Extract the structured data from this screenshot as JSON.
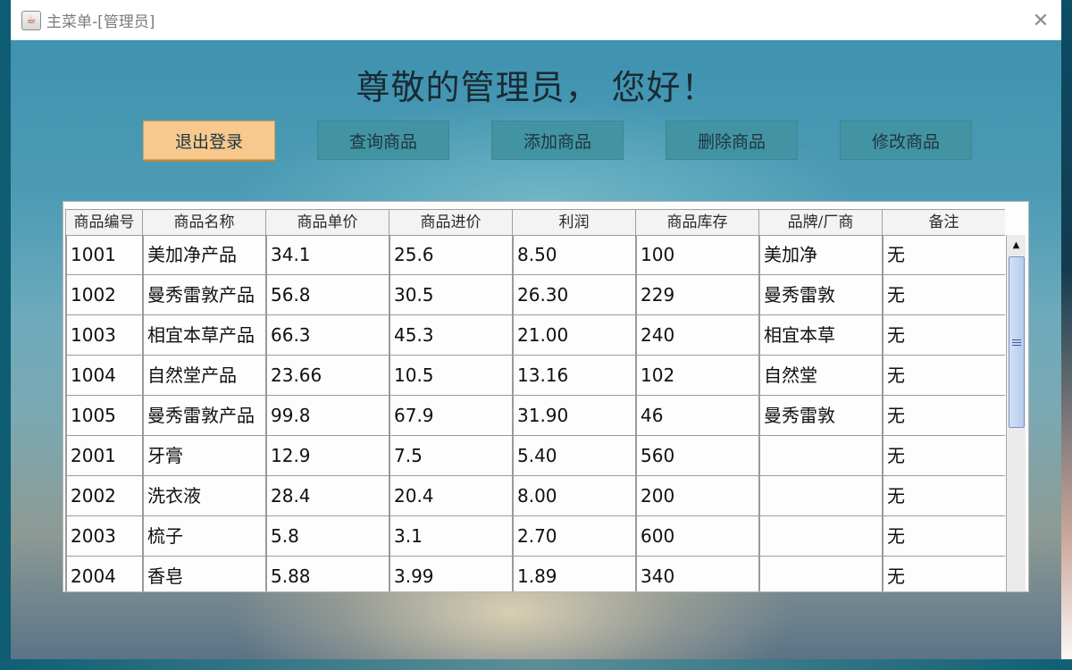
{
  "window": {
    "title": "主菜单-[管理员]",
    "app_icon_glyph": "☕",
    "close_glyph": "✕"
  },
  "greeting": "尊敬的管理员， 您好！",
  "buttons": {
    "logout": "退出登录",
    "query": "查询商品",
    "add": "添加商品",
    "delete": "删除商品",
    "modify": "修改商品"
  },
  "colors": {
    "accent_button": "#f8c98d",
    "normal_button": "#4394a3"
  },
  "table": {
    "headers": [
      "商品编号",
      "商品名称",
      "商品单价",
      "商品进价",
      "利润",
      "商品库存",
      "品牌/厂商",
      "备注"
    ],
    "rows": [
      [
        "1001",
        "美加净产品",
        "34.1",
        "25.6",
        "8.50",
        "100",
        "美加净",
        "无"
      ],
      [
        "1002",
        "曼秀雷敦产品",
        "56.8",
        "30.5",
        "26.30",
        "229",
        "曼秀雷敦",
        "无"
      ],
      [
        "1003",
        "相宜本草产品",
        "66.3",
        "45.3",
        "21.00",
        "240",
        "相宜本草",
        "无"
      ],
      [
        "1004",
        "自然堂产品",
        "23.66",
        "10.5",
        "13.16",
        "102",
        "自然堂",
        "无"
      ],
      [
        "1005",
        "曼秀雷敦产品",
        "99.8",
        "67.9",
        "31.90",
        "46",
        "曼秀雷敦",
        "无"
      ],
      [
        "2001",
        "牙膏",
        "12.9",
        "7.5",
        "5.40",
        "560",
        "",
        "无"
      ],
      [
        "2002",
        "洗衣液",
        "28.4",
        "20.4",
        "8.00",
        "200",
        "",
        "无"
      ],
      [
        "2003",
        "梳子",
        "5.8",
        "3.1",
        "2.70",
        "600",
        "",
        "无"
      ],
      [
        "2004",
        "香皂",
        "5.88",
        "3.99",
        "1.89",
        "340",
        "",
        "无"
      ]
    ]
  },
  "scrollbar": {
    "up_glyph": "▲"
  }
}
